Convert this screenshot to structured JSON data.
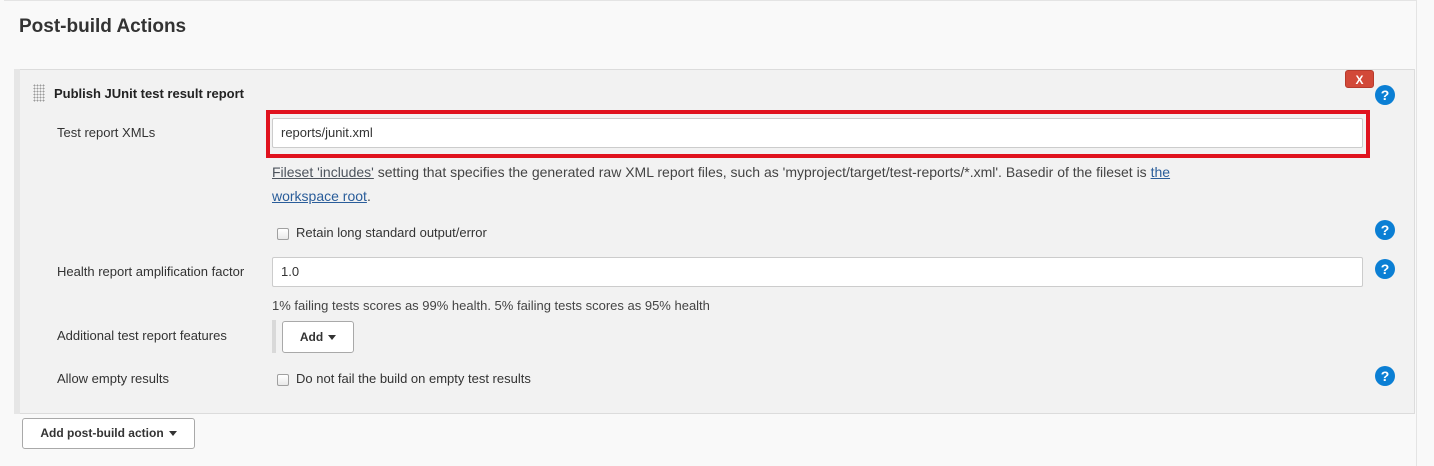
{
  "section": {
    "title": "Post-build Actions"
  },
  "step": {
    "title": "Publish JUnit test result report",
    "delete_label": "X",
    "help_label": "?",
    "test_report_xmls": {
      "label": "Test report XMLs",
      "value": "reports/junit.xml",
      "description": {
        "link1": "Fileset 'includes'",
        "text_mid": " setting that specifies the generated raw XML report files, such as 'myproject/target/test-reports/*.xml'. Basedir of the fileset is ",
        "link2_line1": "the",
        "link2_line2": "workspace root",
        "text_end": "."
      }
    },
    "retain_output": {
      "label": "Retain long standard output/error"
    },
    "health_factor": {
      "label": "Health report amplification factor",
      "value": "1.0",
      "hint": "1% failing tests scores as 99% health. 5% failing tests scores as 95% health"
    },
    "additional_features": {
      "label": "Additional test report features",
      "add_label": "Add"
    },
    "allow_empty": {
      "label": "Allow empty results",
      "checkbox_label": "Do not fail the build on empty test results"
    }
  },
  "footer": {
    "add_action_label": "Add post-build action"
  },
  "colors": {
    "help_icon": "#0b7fd4",
    "delete_button": "#d24939",
    "highlight": "#e0121e"
  }
}
